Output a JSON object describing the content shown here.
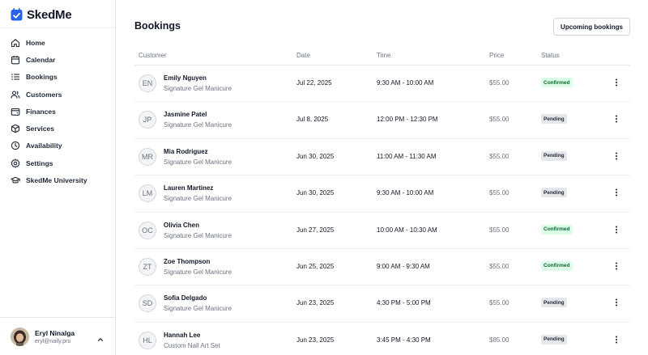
{
  "app": {
    "name": "SkedMe",
    "accent": "#2563eb"
  },
  "sidebar": {
    "items": [
      {
        "label": "Home",
        "icon": "home-icon"
      },
      {
        "label": "Calendar",
        "icon": "calendar-icon"
      },
      {
        "label": "Bookings",
        "icon": "list-icon"
      },
      {
        "label": "Customers",
        "icon": "users-icon"
      },
      {
        "label": "Finances",
        "icon": "wallet-icon"
      },
      {
        "label": "Services",
        "icon": "box-icon"
      },
      {
        "label": "Availability",
        "icon": "clock-icon"
      },
      {
        "label": "Settings",
        "icon": "gear-icon"
      },
      {
        "label": "SkedMe University",
        "icon": "graduation-cap-icon"
      }
    ]
  },
  "user": {
    "name": "Eryl Ninalga",
    "email": "eryl@naily.pro"
  },
  "main": {
    "title": "Bookings",
    "upcoming_button": "Upcoming bookings",
    "columns": {
      "customer": "Customer",
      "date": "Date",
      "time": "Time",
      "price": "Price",
      "status": "Status"
    },
    "rows": [
      {
        "initials": "EN",
        "name": "Emily Nguyen",
        "service": "Signature Gel Manicure",
        "date": "Jul 22, 2025",
        "time": "9:30 AM - 10:00 AM",
        "price": "$55.00",
        "status": "Confirmed"
      },
      {
        "initials": "JP",
        "name": "Jasmine Patel",
        "service": "Signature Gel Manicure",
        "date": "Jul 8, 2025",
        "time": "12:00 PM - 12:30 PM",
        "price": "$55.00",
        "status": "Pending"
      },
      {
        "initials": "MR",
        "name": "Mia Rodriguez",
        "service": "Signature Gel Manicure",
        "date": "Jun 30, 2025",
        "time": "11:00 AM - 11:30 AM",
        "price": "$55.00",
        "status": "Pending"
      },
      {
        "initials": "LM",
        "name": "Lauren Martinez",
        "service": "Signature Gel Manicure",
        "date": "Jun 30, 2025",
        "time": "9:30 AM - 10:00 AM",
        "price": "$55.00",
        "status": "Pending"
      },
      {
        "initials": "OC",
        "name": "Olivia Chen",
        "service": "Signature Gel Manicure",
        "date": "Jun 27, 2025",
        "time": "10:00 AM - 10:30 AM",
        "price": "$55.00",
        "status": "Confirmed"
      },
      {
        "initials": "ZT",
        "name": "Zoe Thompson",
        "service": "Signature Gel Manicure",
        "date": "Jun 25, 2025",
        "time": "9:00 AM - 9:30 AM",
        "price": "$55.00",
        "status": "Confirmed"
      },
      {
        "initials": "SD",
        "name": "Sofia Delgado",
        "service": "Signature Gel Manicure",
        "date": "Jun 23, 2025",
        "time": "4:30 PM - 5:00 PM",
        "price": "$55.00",
        "status": "Pending"
      },
      {
        "initials": "HL",
        "name": "Hannah Lee",
        "service": "Custom Nail Art Set",
        "date": "Jun 23, 2025",
        "time": "3:45 PM - 4:30 PM",
        "price": "$85.00",
        "status": "Pending"
      }
    ]
  }
}
